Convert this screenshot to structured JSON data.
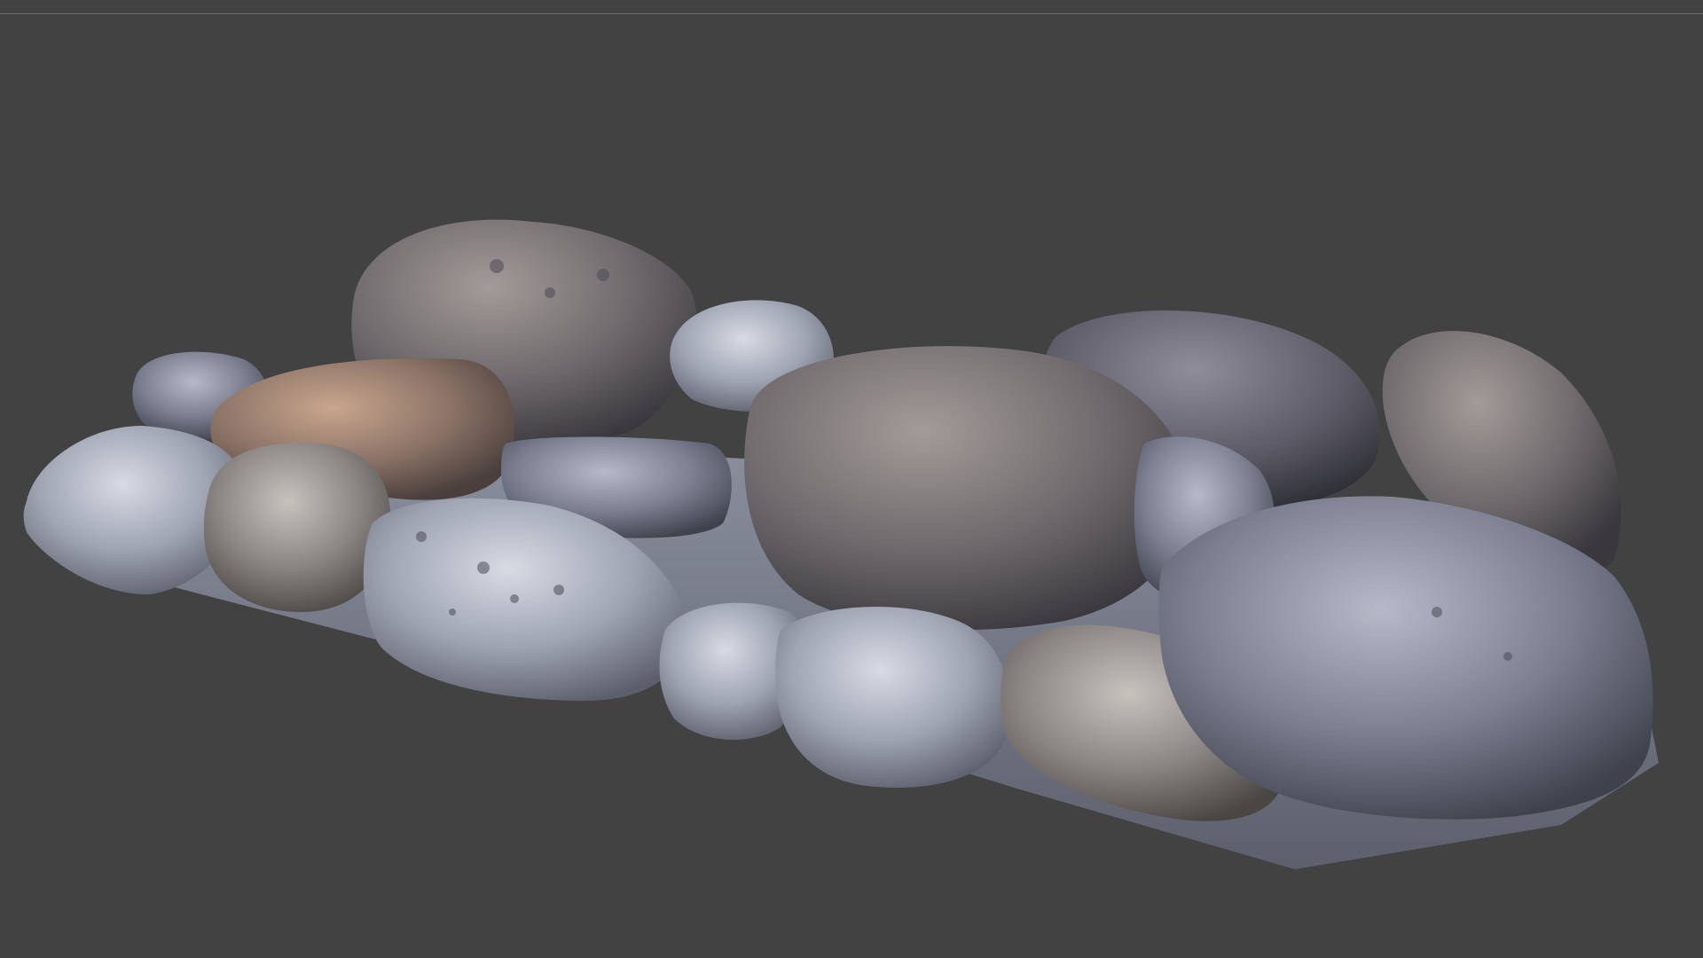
{
  "viewport": {
    "background_color": "#424242",
    "top_rule_color": "#6e6e6e"
  },
  "scene": {
    "rocks": [
      {
        "id": "rock-back-large",
        "tone": "grey-brown"
      },
      {
        "id": "rock-back-center-small",
        "tone": "pale-grey"
      },
      {
        "id": "rock-left-small",
        "tone": "blue-grey"
      },
      {
        "id": "rock-left-brown",
        "tone": "brown"
      },
      {
        "id": "rock-left-pale",
        "tone": "pale-grey"
      },
      {
        "id": "rock-left-mottled",
        "tone": "grey-moss"
      },
      {
        "id": "rock-center-front-spotted",
        "tone": "pale-spotted"
      },
      {
        "id": "rock-center-large",
        "tone": "grey-brown"
      },
      {
        "id": "rock-right-back",
        "tone": "dark-grey"
      },
      {
        "id": "rock-right-tall",
        "tone": "grey-brown"
      },
      {
        "id": "rock-right-front-large",
        "tone": "blue-grey"
      },
      {
        "id": "rock-front-middle",
        "tone": "grey"
      },
      {
        "id": "rock-front-small",
        "tone": "pale-grey"
      }
    ]
  }
}
